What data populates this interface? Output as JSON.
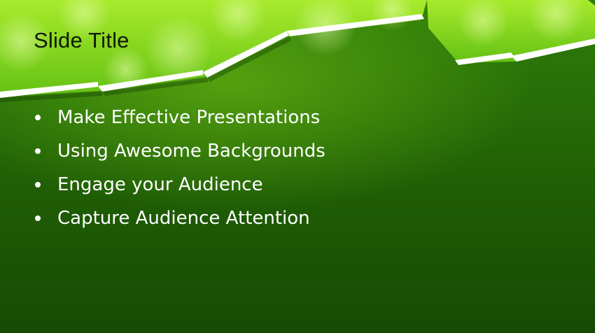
{
  "slide": {
    "title": "Slide Title",
    "bullets": [
      "Make Effective Presentations",
      "Using Awesome Backgrounds",
      "Engage your Audience",
      "Capture Audience Attention"
    ]
  },
  "colors": {
    "background_dark": "#1e5a05",
    "background_light": "#2f7d0a",
    "banner_green": "#7fd81e",
    "banner_highlight": "#b6f04a",
    "title_text": "#0f1a05",
    "bullet_text": "#ffffff",
    "stripe": "#ffffff"
  }
}
